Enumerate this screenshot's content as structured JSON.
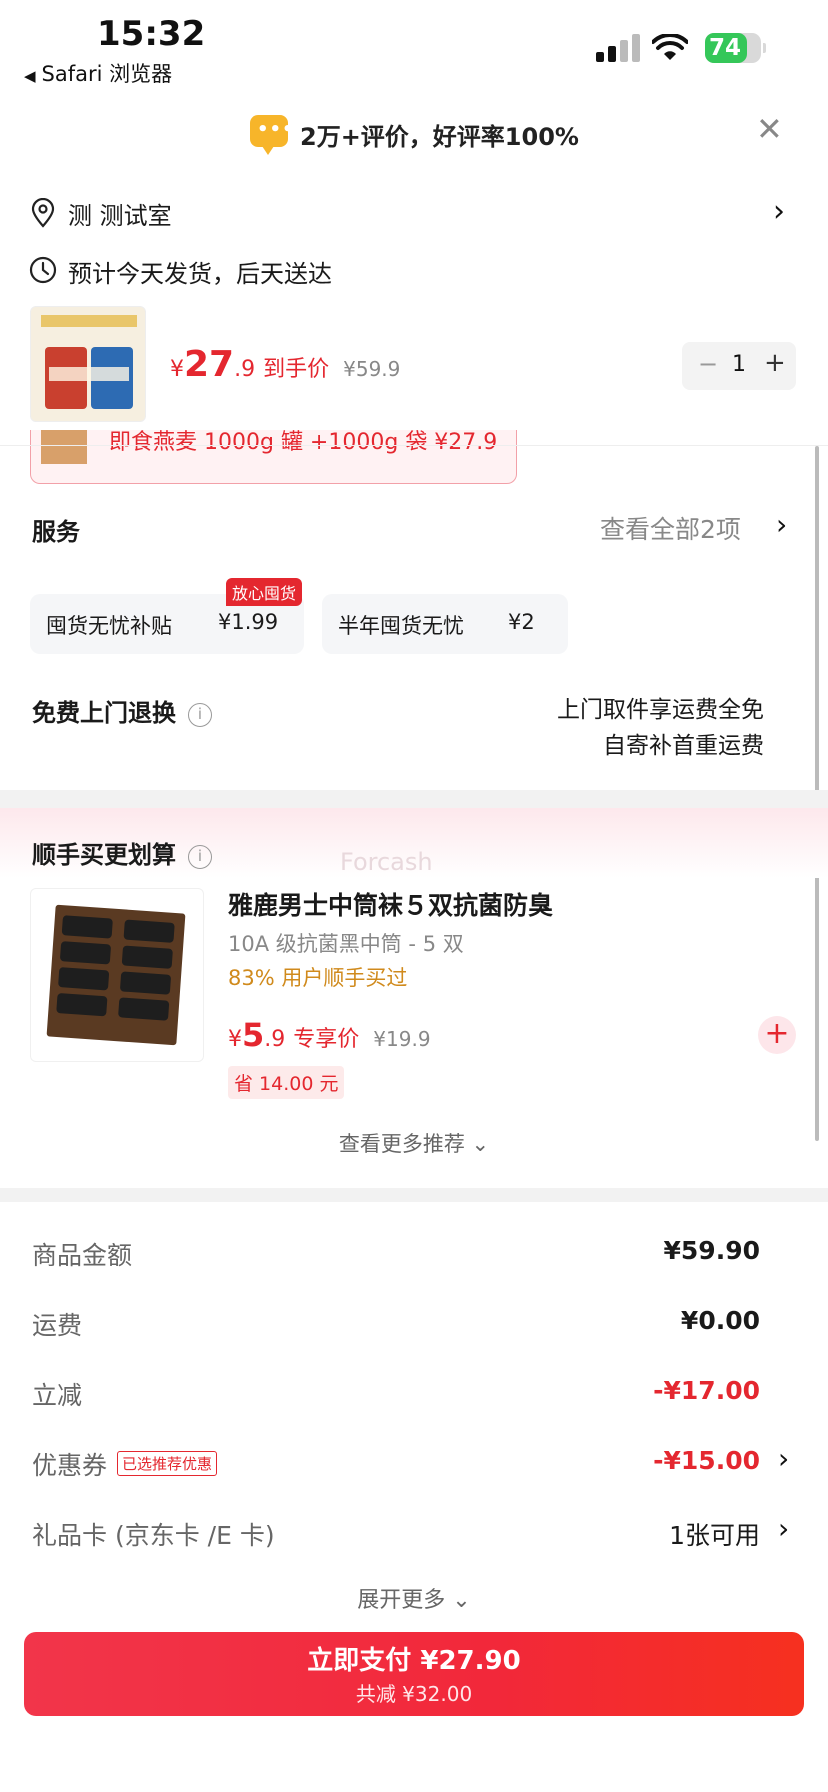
{
  "status_bar": {
    "time": "15:32",
    "back_label": "Safari 浏览器",
    "battery": "74"
  },
  "review_banner": {
    "text": "2万+评价，好评率100%"
  },
  "address": {
    "text": "测 测试室"
  },
  "delivery": {
    "text": "预计今天发货，后天送达"
  },
  "product": {
    "currency": "¥",
    "price_int": "27",
    "price_dec": ".9",
    "price_tag": "到手价",
    "original_price": "¥59.9",
    "quantity": "1",
    "minus": "−",
    "plus": "+"
  },
  "promo_strip": {
    "text": "即食燕麦 1000g 罐 +1000g 袋   ¥27.9"
  },
  "services": {
    "title": "服务",
    "view_all": "查看全部2项",
    "items": [
      {
        "name": "囤货无忧补贴",
        "price": "¥1.99",
        "badge": "放心囤货"
      },
      {
        "name": "半年囤货无忧",
        "price": "¥2"
      }
    ],
    "return_title": "免费上门退换",
    "return_line1": "上门取件享运费全免",
    "return_line2": "自寄补首重运费"
  },
  "upsell": {
    "title": "顺手买更划算",
    "watermark": "Forcash",
    "product_name": "雅鹿男士中筒袜５双抗菌防臭",
    "spec": "10A 级抗菌黑中筒 - 5 双",
    "bought": "83% 用户顺手买过",
    "currency": "¥",
    "price_int": "5",
    "price_dec": ".9",
    "price_tag": "专享价",
    "original_price": "¥19.9",
    "save": "省 14.00 元",
    "more": "查看更多推荐"
  },
  "summary": {
    "rows": [
      {
        "label": "商品金额",
        "value": "¥59.90"
      },
      {
        "label": "运费",
        "value": "¥0.00"
      },
      {
        "label": "立减",
        "value": "-¥17.00"
      },
      {
        "label": "优惠券",
        "badge": "已选推荐优惠",
        "value": "-¥15.00"
      },
      {
        "label": "礼品卡 (京东卡 /E 卡)",
        "value": "1张可用"
      }
    ],
    "expand": "展开更多"
  },
  "pay_button": {
    "main": "立即支付 ¥27.90",
    "sub": "共减 ¥32.00"
  },
  "colors": {
    "accent_red": "#e4272f",
    "battery_green": "#35c759",
    "bought_orange": "#d08a1c"
  }
}
